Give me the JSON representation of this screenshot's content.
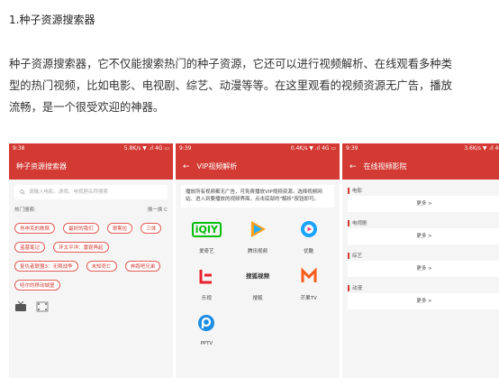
{
  "article": {
    "title": "1.种子资源搜索器",
    "lines": [
      "种子资源搜索器，它不仅能搜索热门的种子资源，它还可以进行视频解析、在线观看多种类",
      "型的热门视频，比如电影、电视剧、综艺、动漫等等。在这里观看的视频资源无广告，播放",
      "流畅，是一个很受欢迎的神器。"
    ]
  },
  "phone1": {
    "time": "9:38",
    "status": "5.8K/s ▼ .ıl 4G ▭",
    "title": "种子资源搜索器",
    "search_placeholder": "请输入电影、游戏、电视剧名称搜索",
    "hot_label": "热门搜索:",
    "refresh_label": "换一换 C",
    "tags": [
      "肖申克的救赎",
      "最好的我们",
      "哥斯拉",
      "三体",
      "盗墓笔记",
      "环太平洋：雷霆再起",
      "复仇者联盟3：无限战争",
      "未知死亡",
      "奔跑吧兄弟",
      "哈尔的移动城堡"
    ]
  },
  "phone2": {
    "time": "9:39",
    "status": "0.4K/s ▼ .ıl 4G ▭",
    "back": "←",
    "title": "VIP视频解析",
    "notice": "播放所有视频都无广告，可免费播放VIP视频资源。选择视频网站、进入到要播放的视频界面，点击底部的\"解析\"按钮即可。",
    "platforms": [
      {
        "name": "爱奇艺",
        "logo_text": "iQIY",
        "color": "#00be06"
      },
      {
        "name": "腾讯视频",
        "logo_text": "▶",
        "color": "#2ab0f0"
      },
      {
        "name": "优酷",
        "logo_text": "▶",
        "color": "#1aa3ff"
      },
      {
        "name": "乐视",
        "logo_text": "L",
        "color": "#e8232f"
      },
      {
        "name": "搜狐",
        "logo_text": "搜狐视频",
        "color": "#e8232f"
      },
      {
        "name": "芒果TV",
        "logo_text": "M",
        "color": "#f95c1c"
      },
      {
        "name": "PPTV",
        "logo_text": "P",
        "color": "#1b8de4"
      }
    ]
  },
  "phone3": {
    "time": "9:39",
    "status": "3.6K/s ▼ .ıl 4G",
    "back": "←",
    "title": "在线视频影院",
    "sections": [
      {
        "label": "电影",
        "more": "更多 >"
      },
      {
        "label": "电视剧",
        "more": "更多 >"
      },
      {
        "label": "综艺",
        "more": "更多 >"
      },
      {
        "label": "动漫",
        "more": "更多 >"
      }
    ]
  }
}
